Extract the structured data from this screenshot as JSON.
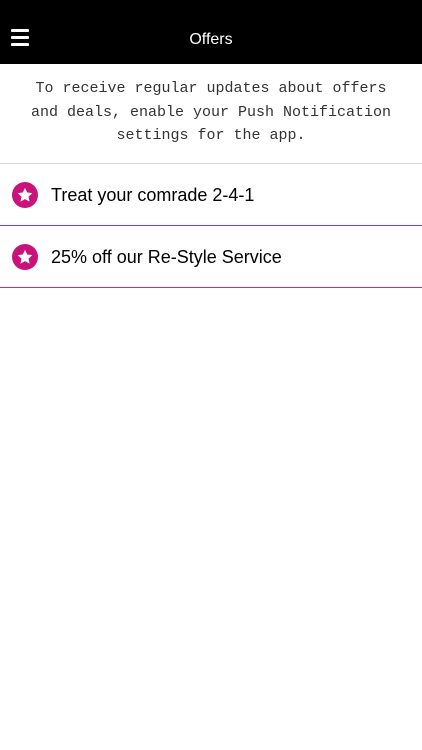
{
  "header": {
    "title": "Offers",
    "menu_icon": "hamburger-menu-icon"
  },
  "notice": {
    "line1": "To receive regular updates about offers",
    "line2": "and deals, enable your Push Notification",
    "line3": "settings for the app."
  },
  "offers": {
    "items": [
      {
        "label": "Treat your comrade 2-4-1",
        "icon": "star-icon"
      },
      {
        "label": "25% off our Re-Style Service",
        "icon": "star-icon"
      }
    ]
  },
  "colors": {
    "header_bg": "#000000",
    "accent": "#c9137a",
    "divider_accent": "#c7307f"
  }
}
